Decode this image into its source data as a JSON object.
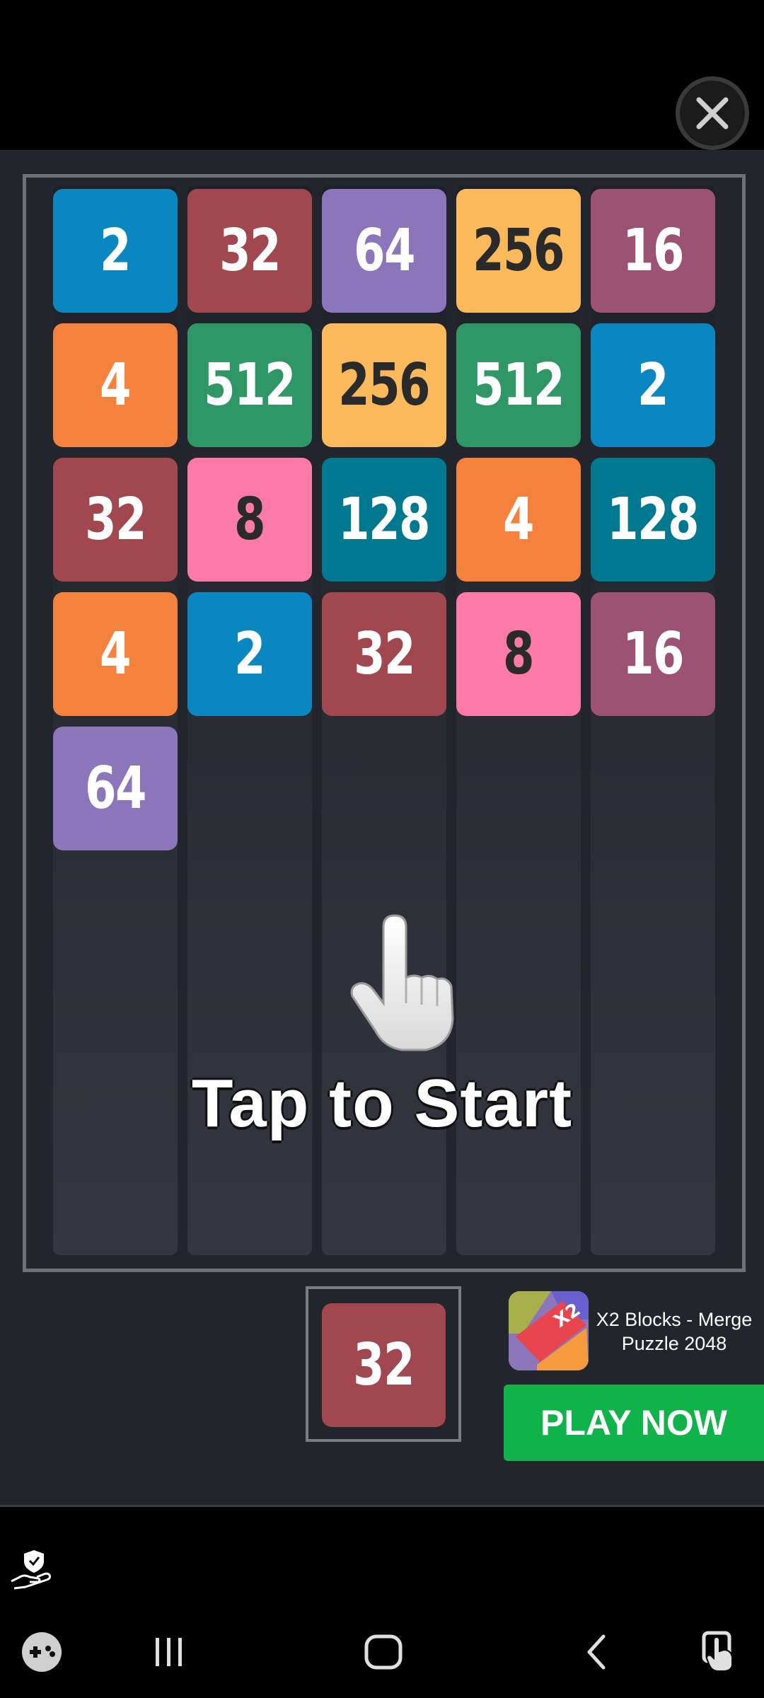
{
  "ad": {
    "close_icon": "close-icon",
    "board_rows": [
      [
        2,
        32,
        64,
        256,
        16
      ],
      [
        4,
        512,
        256,
        512,
        2
      ],
      [
        32,
        8,
        128,
        4,
        128
      ],
      [
        4,
        2,
        32,
        8,
        16
      ],
      [
        64,
        null,
        null,
        null,
        null
      ]
    ],
    "tile_colors": {
      "2": "#0a86c0",
      "4": "#f5823c",
      "8": "#fb7aa8",
      "16": "#9b5273",
      "32": "#a0474f",
      "64": "#8c76bb",
      "128": "#00788f",
      "256": "#fbb95c",
      "512": "#2f9766"
    },
    "dark_text_values": [
      8,
      256
    ],
    "tap_text": "Tap to Start",
    "next_tile": "32",
    "promo": {
      "app_title": "X2 Blocks - Merge Puzzle 2048",
      "icon_label": "X2",
      "play_button": "PLAY NOW"
    }
  },
  "system": {
    "privacy_icon": "privacy-hand-icon",
    "nav": [
      "game-launcher-icon",
      "recent-apps-icon",
      "home-icon",
      "back-icon",
      "accessibility-icon"
    ]
  }
}
